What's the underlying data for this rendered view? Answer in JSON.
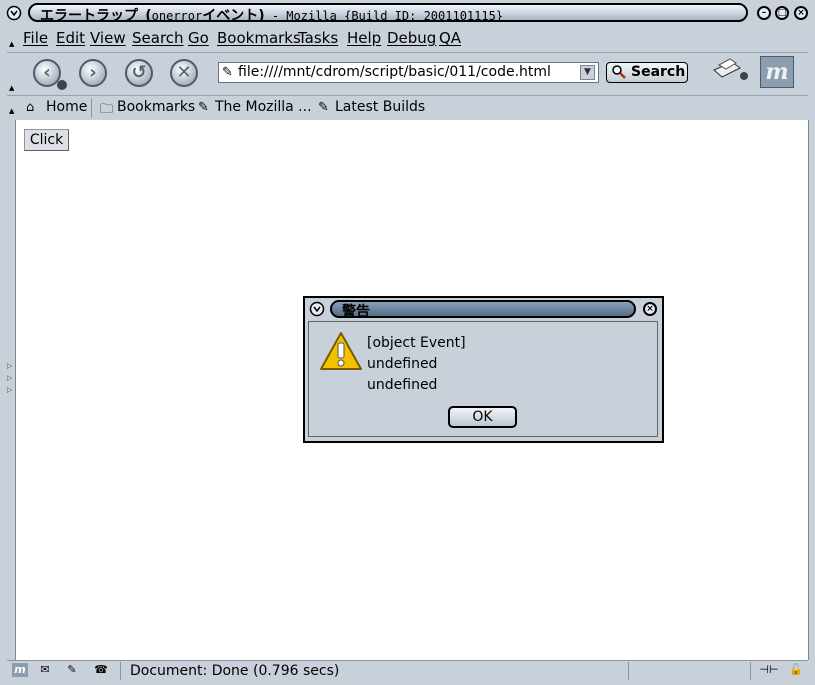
{
  "window": {
    "title_jp": "エラートラップ",
    "title_paren_open": "(",
    "title_onerror": "onerror",
    "title_event": "イベント",
    "title_paren_close": ")",
    "title_suffix": "- Mozilla {Build ID: 2001101115}"
  },
  "menubar": {
    "items": [
      "File",
      "Edit",
      "View",
      "Search",
      "Go",
      "Bookmarks",
      "Tasks",
      "Help",
      "Debug",
      "QA"
    ]
  },
  "navbar": {
    "url": "file:////mnt/cdrom/script/basic/011/code.html",
    "search_label": "Search"
  },
  "personal_bar": {
    "items": [
      "Home",
      "Bookmarks",
      "The Mozilla ...",
      "Latest Builds"
    ]
  },
  "page": {
    "button_label": "Click"
  },
  "dialog": {
    "title": "警告",
    "lines": [
      "[object Event]",
      "undefined",
      "undefined"
    ],
    "ok_label": "OK"
  },
  "status": {
    "text": "Document: Done (0.796 secs)"
  },
  "colors": {
    "chrome": "#c8d0da",
    "content": "#ffffff",
    "warning_yellow": "#f2c200"
  }
}
